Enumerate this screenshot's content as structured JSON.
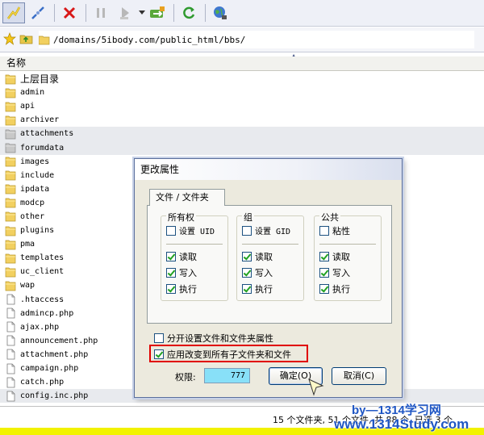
{
  "toolbar": {
    "buttons": [
      "connect-icon",
      "disconnect-icon",
      "stop-icon",
      "pause-icon",
      "play-icon",
      "dropdown-icon",
      "transfer-icon",
      "refresh-icon",
      "globe-icon"
    ]
  },
  "address": {
    "path": "/domains/5ibody.com/public_html/bbs/"
  },
  "column_header": "名称",
  "files": [
    {
      "name": "上层目录",
      "type": "up"
    },
    {
      "name": "admin",
      "type": "folder"
    },
    {
      "name": "api",
      "type": "folder"
    },
    {
      "name": "archiver",
      "type": "folder"
    },
    {
      "name": "attachments",
      "type": "folder-gray",
      "selected": true
    },
    {
      "name": "forumdata",
      "type": "folder-gray",
      "selected": true
    },
    {
      "name": "images",
      "type": "folder"
    },
    {
      "name": "include",
      "type": "folder"
    },
    {
      "name": "ipdata",
      "type": "folder"
    },
    {
      "name": "modcp",
      "type": "folder"
    },
    {
      "name": "other",
      "type": "folder"
    },
    {
      "name": "plugins",
      "type": "folder"
    },
    {
      "name": "pma",
      "type": "folder"
    },
    {
      "name": "templates",
      "type": "folder"
    },
    {
      "name": "uc_client",
      "type": "folder"
    },
    {
      "name": "wap",
      "type": "folder"
    },
    {
      "name": ".htaccess",
      "type": "file"
    },
    {
      "name": "admincp.php",
      "type": "file"
    },
    {
      "name": "ajax.php",
      "type": "file"
    },
    {
      "name": "announcement.php",
      "type": "file"
    },
    {
      "name": "attachment.php",
      "type": "file"
    },
    {
      "name": "campaign.php",
      "type": "file"
    },
    {
      "name": "catch.php",
      "type": "file"
    },
    {
      "name": "config.inc.php",
      "type": "file",
      "selected": true
    }
  ],
  "status": {
    "text": "15 个文件夹, 51 个文件, 共 88 个, 已选 3 个"
  },
  "watermark": {
    "line1": "by—1314学习网",
    "line2": "www.1314Study.com"
  },
  "dialog": {
    "title": "更改属性",
    "tab": "文件 / 文件夹",
    "groups": [
      {
        "title": "所有权",
        "special_label": "设置 UID",
        "special_checked": false,
        "perms": [
          {
            "label": "读取",
            "checked": true
          },
          {
            "label": "写入",
            "checked": true
          },
          {
            "label": "执行",
            "checked": true
          }
        ]
      },
      {
        "title": "组",
        "special_label": "设置 GID",
        "special_checked": false,
        "perms": [
          {
            "label": "读取",
            "checked": true
          },
          {
            "label": "写入",
            "checked": true
          },
          {
            "label": "执行",
            "checked": true
          }
        ]
      },
      {
        "title": "公共",
        "special_label": "粘性",
        "special_checked": false,
        "perms": [
          {
            "label": "读取",
            "checked": true
          },
          {
            "label": "写入",
            "checked": true
          },
          {
            "label": "执行",
            "checked": true
          }
        ]
      }
    ],
    "separate_option": {
      "label": "分开设置文件和文件夹属性",
      "checked": false
    },
    "apply_option": {
      "label": "应用改变到所有子文件夹和文件",
      "checked": true
    },
    "permission_label": "权限:",
    "permission_value": "777",
    "ok_label": "确定(O)",
    "cancel_label": "取消(C)"
  }
}
